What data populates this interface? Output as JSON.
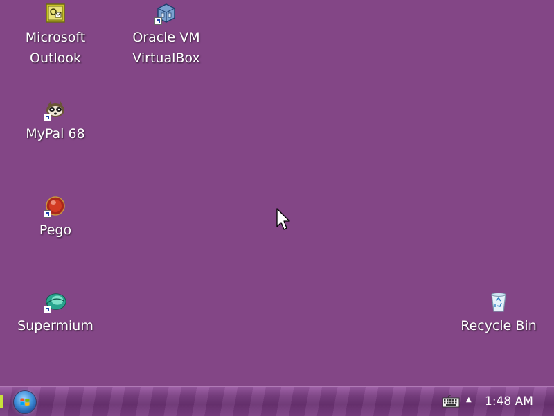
{
  "desktop": {
    "background_color": "#834686",
    "icons": [
      {
        "label": "Microsoft\nOutlook",
        "icon": "outlook-icon"
      },
      {
        "label": "Oracle VM\nVirtualBox",
        "icon": "virtualbox-icon"
      },
      {
        "label": "MyPal 68",
        "icon": "mypal-icon"
      },
      {
        "label": "Pego",
        "icon": "pego-icon"
      },
      {
        "label": "Supermium",
        "icon": "supermium-icon"
      },
      {
        "label": "Recycle Bin",
        "icon": "recycle-bin-icon"
      }
    ]
  },
  "taskbar": {
    "start_icon": "windows-logo-icon",
    "tray": {
      "keyboard_icon": "on-screen-keyboard-icon",
      "chevron": "▲",
      "clock": "1:48 AM"
    }
  }
}
